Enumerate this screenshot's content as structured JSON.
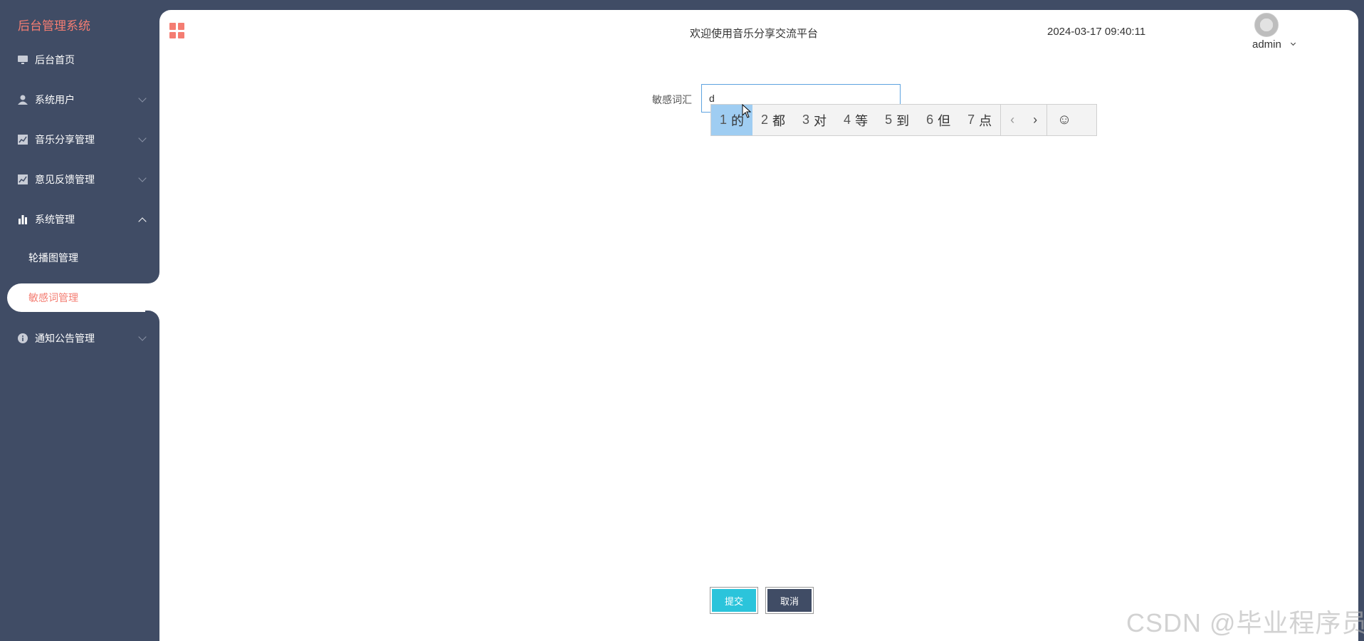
{
  "app": {
    "title": "后台管理系统"
  },
  "sidebar": {
    "items": [
      {
        "label": "后台首页",
        "icon": "monitor-icon"
      },
      {
        "label": "系统用户",
        "icon": "user-icon"
      },
      {
        "label": "音乐分享管理",
        "icon": "chart-icon"
      },
      {
        "label": "意见反馈管理",
        "icon": "chart-icon"
      },
      {
        "label": "系统管理",
        "icon": "bar-chart-icon"
      },
      {
        "label": "通知公告管理",
        "icon": "info-icon"
      }
    ],
    "sub_items": [
      {
        "label": "轮播图管理"
      },
      {
        "label": "敏感词管理",
        "active": true
      }
    ]
  },
  "header": {
    "title": "欢迎使用音乐分享交流平台",
    "time": "2024-03-17 09:40:11",
    "user": "admin"
  },
  "form": {
    "label": "敏感词汇",
    "value": "d"
  },
  "ime": {
    "candidates": [
      {
        "num": "1",
        "char": "的"
      },
      {
        "num": "2",
        "char": "都"
      },
      {
        "num": "3",
        "char": "对"
      },
      {
        "num": "4",
        "char": "等"
      },
      {
        "num": "5",
        "char": "到"
      },
      {
        "num": "6",
        "char": "但"
      },
      {
        "num": "7",
        "char": "点"
      }
    ],
    "prev": "‹",
    "next": "›",
    "emoji": "☺"
  },
  "buttons": {
    "submit": "提交",
    "cancel": "取消"
  },
  "watermark": "CSDN @毕业程序员",
  "colors": {
    "sidebar_bg": "#404c65",
    "accent": "#f47d72",
    "submit": "#2bc4db"
  }
}
